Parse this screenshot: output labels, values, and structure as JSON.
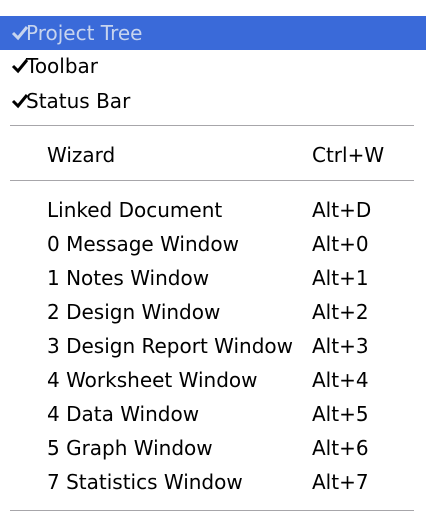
{
  "menu": {
    "items": [
      {
        "label": "Project Tree",
        "checked": true,
        "highlighted": true
      },
      {
        "label": "Toolbar",
        "checked": true
      },
      {
        "label": "Status Bar",
        "checked": true
      },
      {
        "label": "Wizard",
        "shortcut": "Ctrl+W"
      },
      {
        "label": "Linked Document",
        "shortcut": "Alt+D"
      },
      {
        "label": "0 Message Window",
        "shortcut": "Alt+0"
      },
      {
        "label": "1 Notes Window",
        "shortcut": "Alt+1"
      },
      {
        "label": "2 Design Window",
        "shortcut": "Alt+2"
      },
      {
        "label": "3 Design Report Window",
        "shortcut": "Alt+3"
      },
      {
        "label": "4 Worksheet Window",
        "shortcut": "Alt+4"
      },
      {
        "label": "4 Data Window",
        "shortcut": "Alt+5"
      },
      {
        "label": "5 Graph Window",
        "shortcut": "Alt+6"
      },
      {
        "label": "7 Statistics Window",
        "shortcut": "Alt+7"
      }
    ],
    "check_icon": "checkmark-icon",
    "colors": {
      "highlight": "#3a6ad9",
      "highlight_text": "#c7d4ee",
      "separator": "#a7a6aa"
    }
  }
}
